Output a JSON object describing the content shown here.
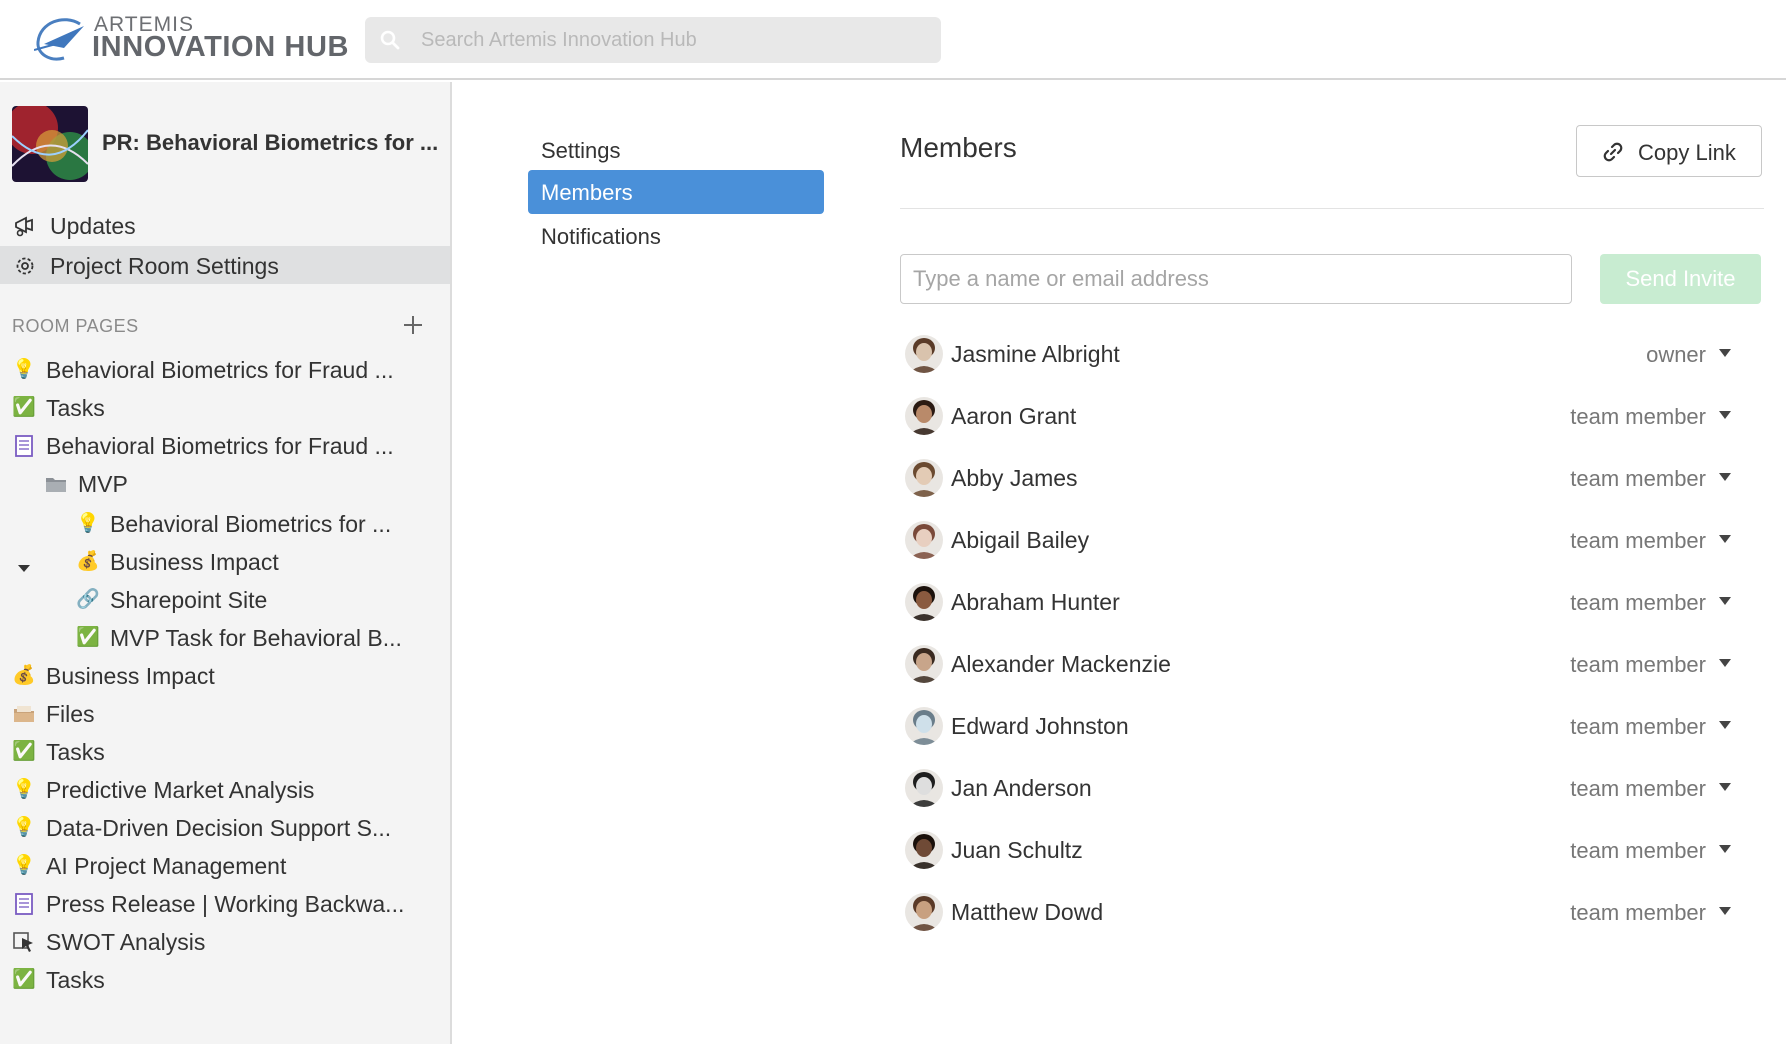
{
  "brand": {
    "small": "ARTEMIS",
    "big": "INNOVATION HUB"
  },
  "search": {
    "placeholder": "Search Artemis Innovation Hub"
  },
  "sidebar": {
    "room_title": "PR: Behavioral Biometrics for ...",
    "nav": [
      {
        "label": "Updates",
        "icon": "megaphone-icon"
      },
      {
        "label": "Project Room Settings",
        "icon": "gear-icon"
      }
    ],
    "section_label": "ROOM PAGES",
    "pages": [
      {
        "label": "Behavioral Biometrics for Fraud ...",
        "icon": "💡"
      },
      {
        "label": "Tasks",
        "icon": "✅"
      },
      {
        "label": "Behavioral Biometrics for Fraud ...",
        "icon": "document-icon"
      },
      {
        "label": "MVP",
        "icon": "folder-icon"
      },
      {
        "label": "Behavioral Biometrics for ...",
        "icon": "💡"
      },
      {
        "label": "Business Impact",
        "icon": "💰"
      },
      {
        "label": "Sharepoint Site",
        "icon": "🔗"
      },
      {
        "label": "MVP Task for Behavioral B...",
        "icon": "✅"
      },
      {
        "label": "Business Impact",
        "icon": "💰"
      },
      {
        "label": "Files",
        "icon": "files-icon"
      },
      {
        "label": "Tasks",
        "icon": "✅"
      },
      {
        "label": "Predictive Market Analysis",
        "icon": "💡"
      },
      {
        "label": "Data-Driven Decision Support S...",
        "icon": "💡"
      },
      {
        "label": "AI Project Management",
        "icon": "💡"
      },
      {
        "label": "Press Release | Working Backwa...",
        "icon": "document-icon"
      },
      {
        "label": "SWOT Analysis",
        "icon": "cursor-icon"
      },
      {
        "label": "Tasks",
        "icon": "✅"
      }
    ]
  },
  "settings_nav": {
    "items": [
      {
        "label": "Settings"
      },
      {
        "label": "Members"
      },
      {
        "label": "Notifications"
      }
    ],
    "active": "Members"
  },
  "main": {
    "title": "Members",
    "copy_link": "Copy Link",
    "invite_placeholder": "Type a name or email address",
    "send_invite": "Send Invite",
    "members": [
      {
        "name": "Jasmine Albright",
        "role": "owner"
      },
      {
        "name": "Aaron Grant",
        "role": "team member"
      },
      {
        "name": "Abby James",
        "role": "team member"
      },
      {
        "name": "Abigail Bailey",
        "role": "team member"
      },
      {
        "name": "Abraham Hunter",
        "role": "team member"
      },
      {
        "name": "Alexander Mackenzie",
        "role": "team member"
      },
      {
        "name": "Edward Johnston",
        "role": "team member"
      },
      {
        "name": "Jan Anderson",
        "role": "team member"
      },
      {
        "name": "Juan Schultz",
        "role": "team member"
      },
      {
        "name": "Matthew Dowd",
        "role": "team member"
      }
    ]
  },
  "colors": {
    "accent": "#4a90d9",
    "send_invite_bg": "#c8ecd1",
    "sidebar_bg": "#f4f4f4"
  }
}
